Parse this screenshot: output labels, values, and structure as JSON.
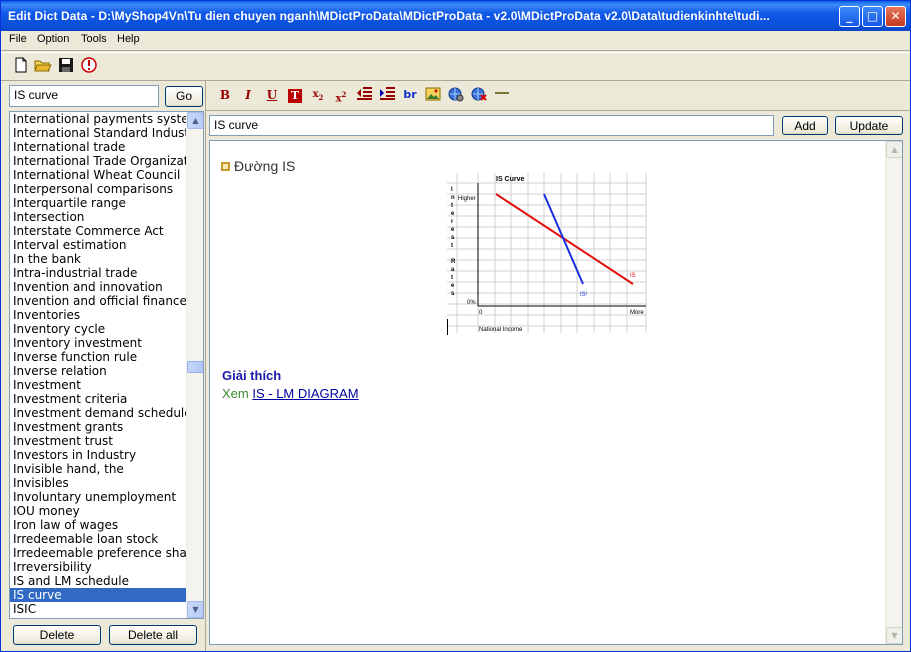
{
  "window": {
    "title": "Edit Dict Data - D:\\MyShop4Vn\\Tu dien chuyen nganh\\MDictProData\\MDictProData - v2.0\\MDictProData v2.0\\Data\\tudienkinhte\\tudi...",
    "min_symbol": "_",
    "max_symbol": "□",
    "close_symbol": "✕"
  },
  "menu": {
    "file": "File",
    "option": "Option",
    "tools": "Tools",
    "help": "Help"
  },
  "toolbar": {
    "new_icon": "new-file-icon",
    "open_icon": "open-folder-icon",
    "save_icon": "save-icon",
    "info_icon": "info-icon"
  },
  "search": {
    "value": "IS curve",
    "go_label": "Go"
  },
  "word_list": [
    "International payments system",
    "International Standard Industrial Classification",
    "International trade",
    "International Trade Organization",
    "International Wheat Council",
    "Interpersonal comparisons",
    "Interquartile range",
    "Intersection",
    "Interstate Commerce Act",
    "Interval estimation",
    "In the bank",
    "Intra-industrial trade",
    "Invention and innovation",
    "Invention and official finance",
    "Inventories",
    "Inventory cycle",
    "Inventory investment",
    "Inverse function rule",
    "Inverse relation",
    "Investment",
    "Investment criteria",
    "Investment demand schedule",
    "Investment grants",
    "Investment trust",
    "Investors in Industry",
    "Invisible hand, the",
    "Invisibles",
    "Involuntary unemployment",
    "IOU money",
    "Iron law of wages",
    "Irredeemable loan stock",
    "Irredeemable preference shares",
    "Irreversibility",
    "IS and LM schedule",
    "IS curve",
    "ISIC"
  ],
  "selected_word": "IS curve",
  "buttons": {
    "delete": "Delete",
    "delete_all": "Delete all",
    "add": "Add",
    "update": "Update"
  },
  "format_bar": {
    "bold": "B",
    "italic": "I",
    "underline": "U",
    "color": "T",
    "subscript": "x",
    "sub_index": "2",
    "superscript": "x",
    "sup_index": "2",
    "br": "br"
  },
  "entry": {
    "word": "IS curve",
    "heading": "Đường IS",
    "explain_label": "Giải thích",
    "see_label": "Xem",
    "see_link": "IS - LM DIAGRAM"
  },
  "graph": {
    "title": "IS Curve",
    "y_axis_letters": [
      "I",
      "n",
      "t",
      "e",
      "r",
      "e",
      "s",
      "t",
      "",
      "R",
      "a",
      "t",
      "e",
      "s"
    ],
    "y_high": "Higher",
    "y_zero": "0%",
    "x_zero": "0",
    "x_more": "More",
    "x_label": "National Income",
    "curve_is": "IS",
    "curve_is1": "IS¹",
    "colors": {
      "is": "#e01010",
      "is1": "#1a2ee0"
    }
  }
}
